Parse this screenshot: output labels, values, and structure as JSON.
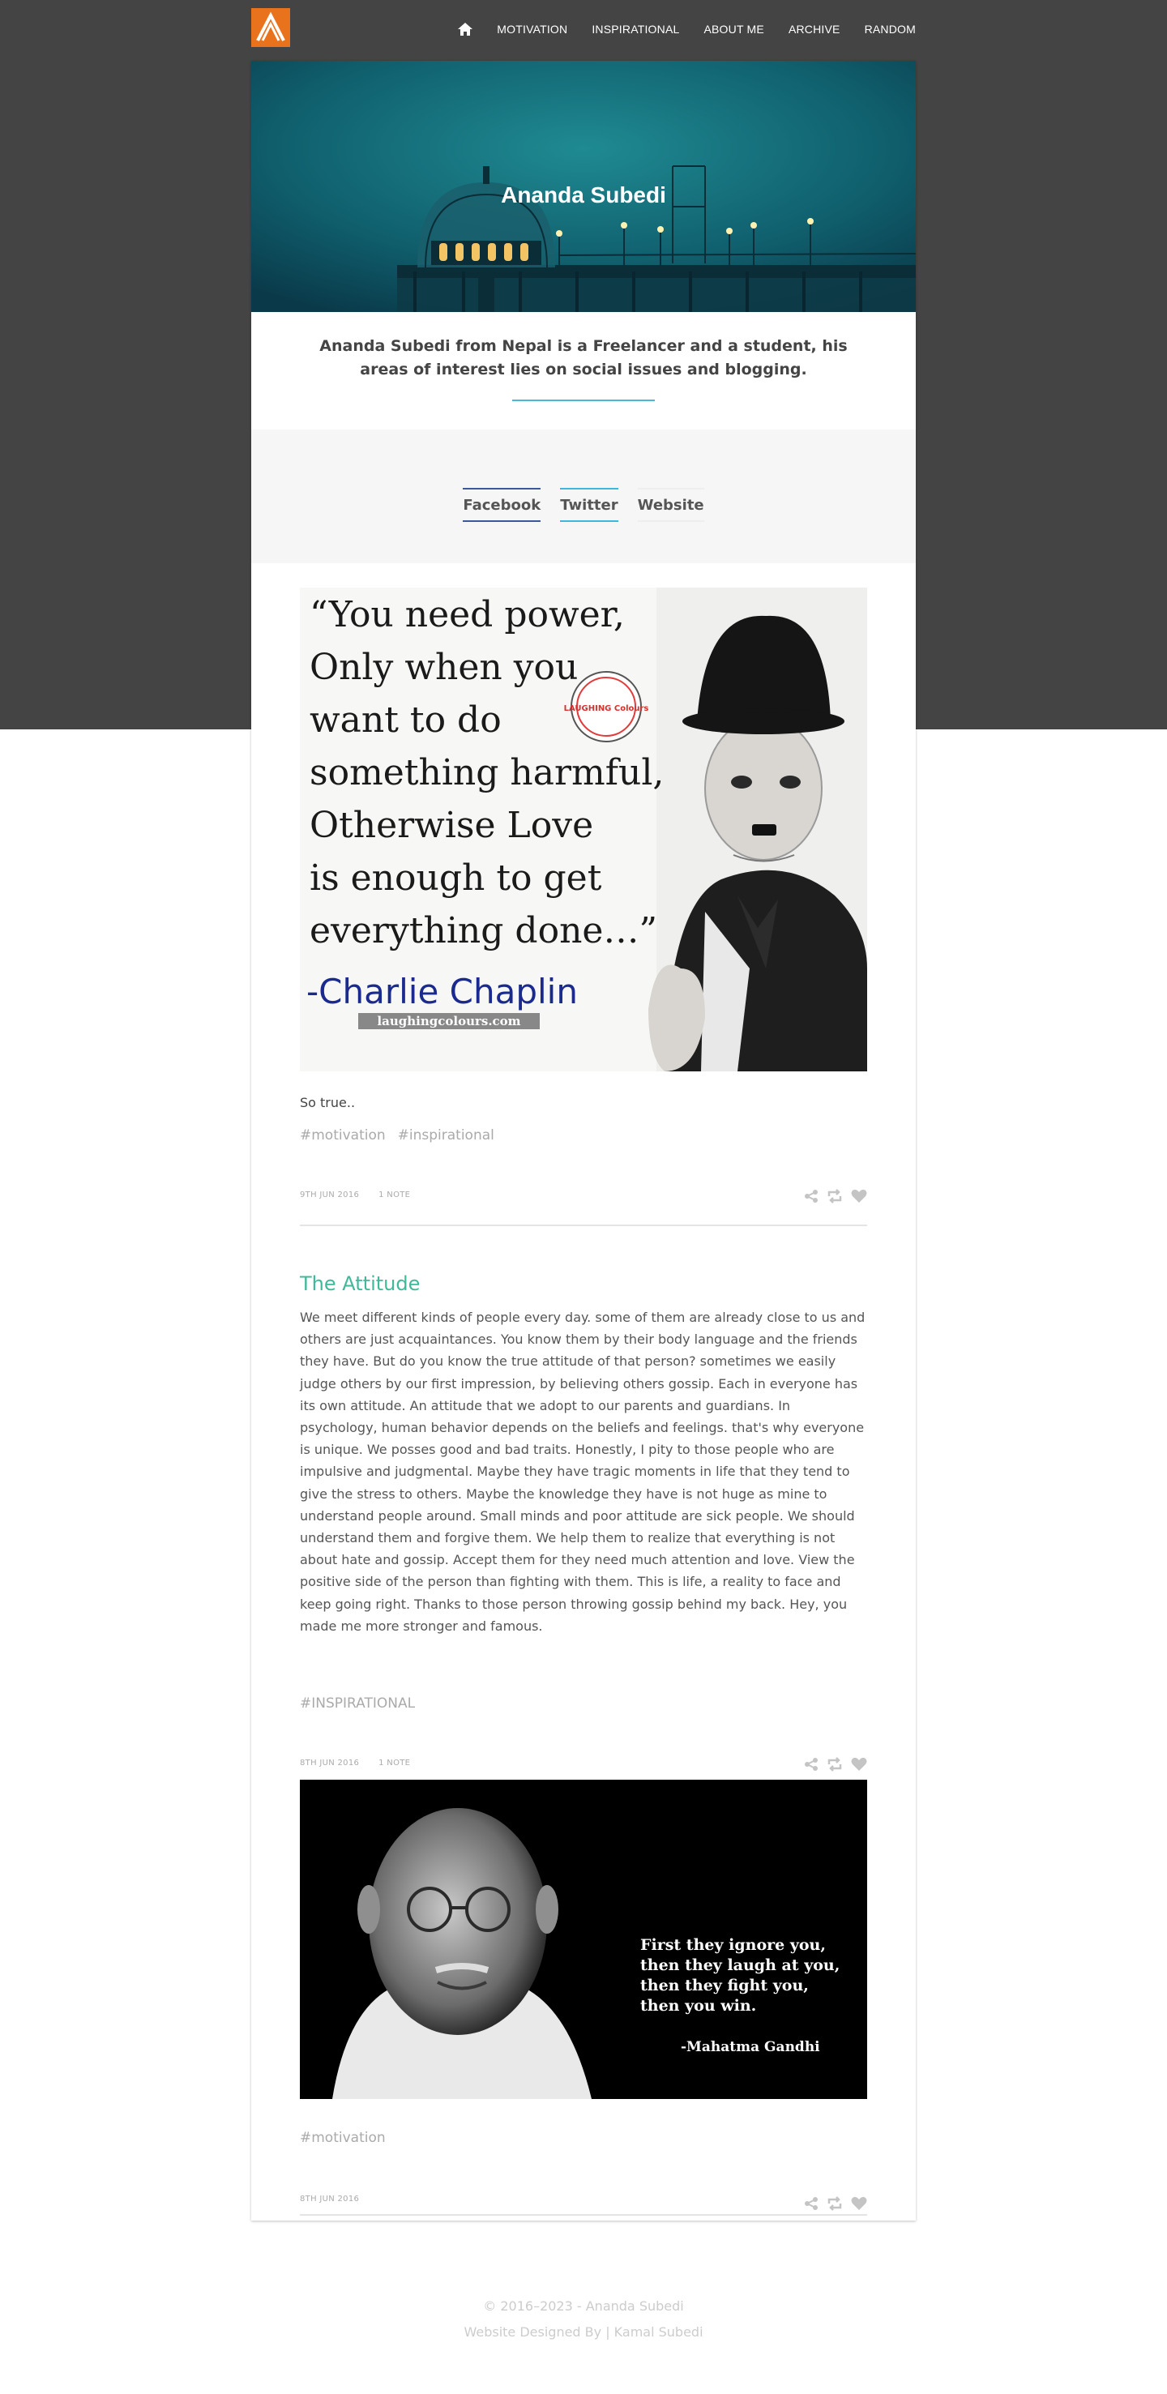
{
  "nav": {
    "links": [
      "MOTIVATION",
      "INSPIRATIONAL",
      "ABOUT ME",
      "ARCHIVE",
      "RANDOM"
    ]
  },
  "header": {
    "title": "Ananda Subedi",
    "bio": "Ananda Subedi from Nepal is a Freelancer and a student, his areas of interest lies on social issues and blogging."
  },
  "social": {
    "facebook": "Facebook",
    "twitter": "Twitter",
    "website": "Website"
  },
  "posts": [
    {
      "image": {
        "quote_lines": [
          "“You need power,",
          "Only when you",
          "want to do",
          "something harmful,",
          "Otherwise Love",
          "is enough to get",
          "everything done…”"
        ],
        "author": "-Charlie Chaplin",
        "watermark": "laughingcolours.com",
        "badge": "LAUGHING Colours"
      },
      "caption": "So true..",
      "tags": [
        "#motivation",
        "#inspirational"
      ],
      "date": "9TH JUN 2016",
      "notes": "1 NOTE"
    },
    {
      "title": "The Attitude",
      "body": "We meet different kinds of people every day. some of them are already close to us and others are just acquaintances. You know them by their body language and the friends they have. But do you know the true attitude of that person? sometimes we easily judge others by our first impression, by believing others gossip. Each in everyone has its own attitude. An attitude that we adopt to our parents and guardians. In psychology, human behavior depends on the beliefs and feelings. that's why everyone is unique. We posses good and bad traits. Honestly, I pity to those people who are impulsive and judgmental. Maybe they have tragic moments in life that they tend to give the stress to others. Maybe the knowledge they have is not huge as mine to understand people around. Small minds and poor attitude are sick people. We should understand them and forgive them. We help them to realize that everything is not about hate and gossip. Accept them for they need much attention and love. View the positive side of the person than fighting with them. This is life, a reality to face and keep going right. Thanks to those person throwing gossip behind my back. Hey, you made me more stronger and famous.",
      "tags": [
        "#INSPIRATIONAL"
      ],
      "date": "8TH JUN 2016",
      "notes": "1 NOTE"
    },
    {
      "image": {
        "quote_lines": [
          "First they ignore you,",
          "then they laugh at you,",
          "then they fight you,",
          "then you win."
        ],
        "author": "-Mahatma Gandhi"
      },
      "tags": [
        "#motivation"
      ],
      "date": "8TH JUN 2016"
    }
  ],
  "footer": {
    "copyright": "© 2016–2023 - Ananda Subedi",
    "credit": "Website Designed By | Kamal Subedi"
  },
  "colors": {
    "accent_orange": "#e8731c",
    "title_green": "#3fb99a",
    "facebook_blue": "#3b5998",
    "twitter_blue": "#3cb7e0"
  }
}
